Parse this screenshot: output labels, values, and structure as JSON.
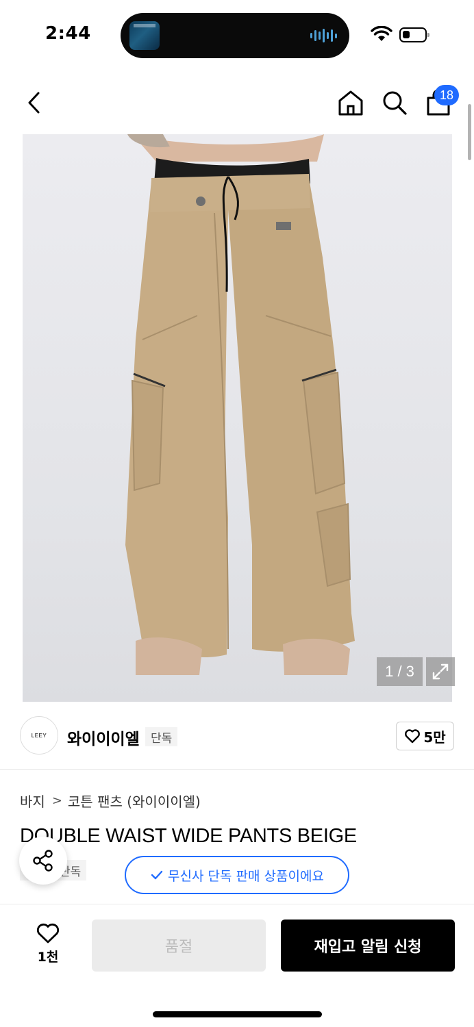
{
  "status_bar": {
    "time": "2:44",
    "wave_heights": [
      8,
      16,
      12,
      20,
      10,
      18,
      7
    ]
  },
  "nav": {
    "back_icon": "chevron-left-icon",
    "home_icon": "home-icon",
    "search_icon": "search-icon",
    "cart_icon": "shopping-bag-icon",
    "cart_count": "18",
    "accent_color": "#1f6bff"
  },
  "gallery": {
    "counter": "1 / 3",
    "expand_icon": "expand-icon"
  },
  "brand": {
    "logo_text": "LEEY",
    "name": "와이이이엘",
    "exclusive_label": "단독",
    "like_count": "5만"
  },
  "product": {
    "breadcrumb": [
      "바지",
      "코튼 팬츠 (와이이이엘)"
    ],
    "title": "DOUBLE WAIST WIDE PANTS BEIGE",
    "sub_tag": "단독",
    "tooltip": "무신사 단독 판매 상품이에요"
  },
  "bottom_bar": {
    "wish_count": "1천",
    "soldout_label": "품절",
    "restock_label": "재입고 알림 신청"
  }
}
